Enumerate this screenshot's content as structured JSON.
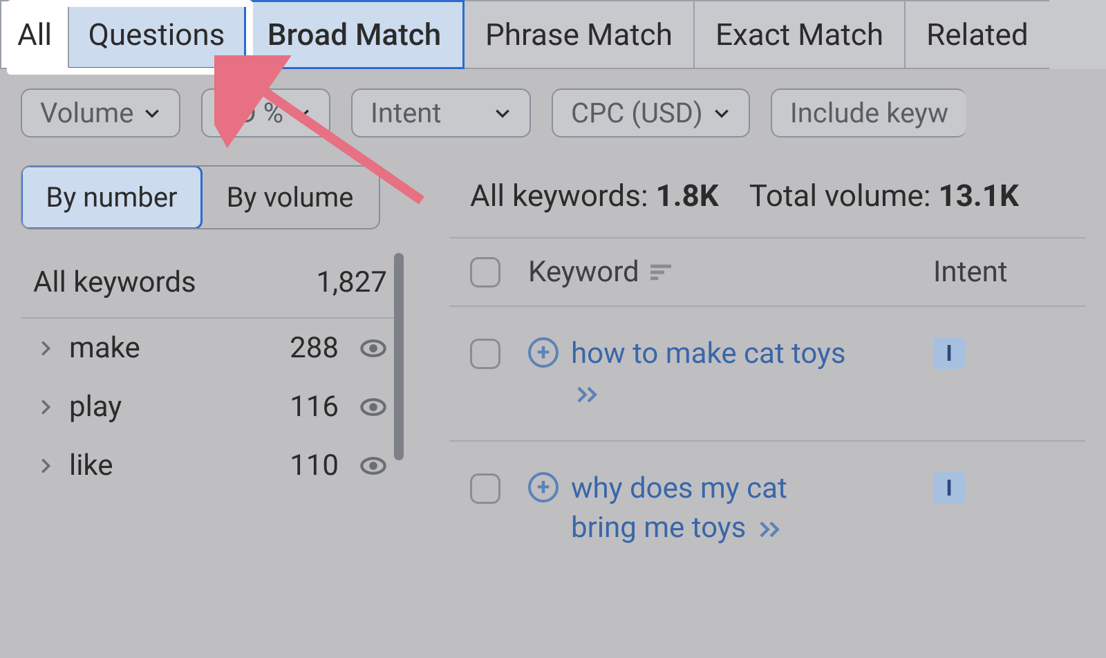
{
  "tabs": {
    "all": "All",
    "questions": "Questions",
    "broad": "Broad Match",
    "phrase": "Phrase Match",
    "exact": "Exact Match",
    "related": "Related"
  },
  "filters": {
    "volume": "Volume",
    "kd": "KD %",
    "intent": "Intent",
    "cpc": "CPC (USD)",
    "include": "Include keyw"
  },
  "segment": {
    "by_number": "By number",
    "by_volume": "By volume"
  },
  "sidebar": {
    "all_label": "All keywords",
    "all_count": "1,827",
    "items": [
      {
        "label": "make",
        "count": "288"
      },
      {
        "label": "play",
        "count": "116"
      },
      {
        "label": "like",
        "count": "110"
      }
    ]
  },
  "summary": {
    "all_label": "All keywords:",
    "all_value": "1.8K",
    "total_label": "Total volume:",
    "total_value": "13.1K"
  },
  "table": {
    "head_keyword": "Keyword",
    "head_intent": "Intent",
    "rows": [
      {
        "keyword": "how to make cat toys",
        "intent": "I"
      },
      {
        "keyword": "why does my cat bring me toys",
        "intent": "I"
      }
    ]
  }
}
